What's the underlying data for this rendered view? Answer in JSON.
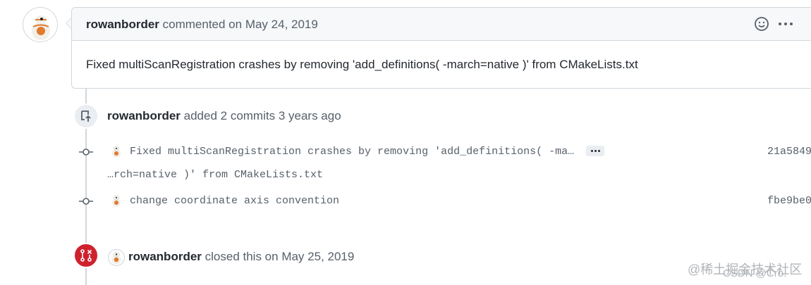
{
  "comment": {
    "author": "rowanborder",
    "action": "commented on May 24, 2019",
    "body": "Fixed multiScanRegistration crashes by removing 'add_definitions( -march=native )' from CMakeLists.txt",
    "emoji_icon": "smiley-icon",
    "more_icon": "kebab-horizontal-icon"
  },
  "commits_event": {
    "author": "rowanborder",
    "action": "added 2 commits 3 years ago",
    "icon": "repo-push-icon"
  },
  "commits": [
    {
      "message_line1": "Fixed multiScanRegistration crashes by removing 'add_definitions( -ma…",
      "message_line2": "…rch=native )' from CMakeLists.txt",
      "sha": "21a5849"
    },
    {
      "message_line1": "change coordinate axis convention",
      "sha": "fbe9be0"
    }
  ],
  "closed_event": {
    "author": "rowanborder",
    "action": "closed this on May 25, 2019",
    "icon": "git-pull-request-closed-icon",
    "color": "#cf222e"
  },
  "watermark": {
    "line1": "@稀土掘金技术社区",
    "line2": "CSDN @Cro."
  }
}
